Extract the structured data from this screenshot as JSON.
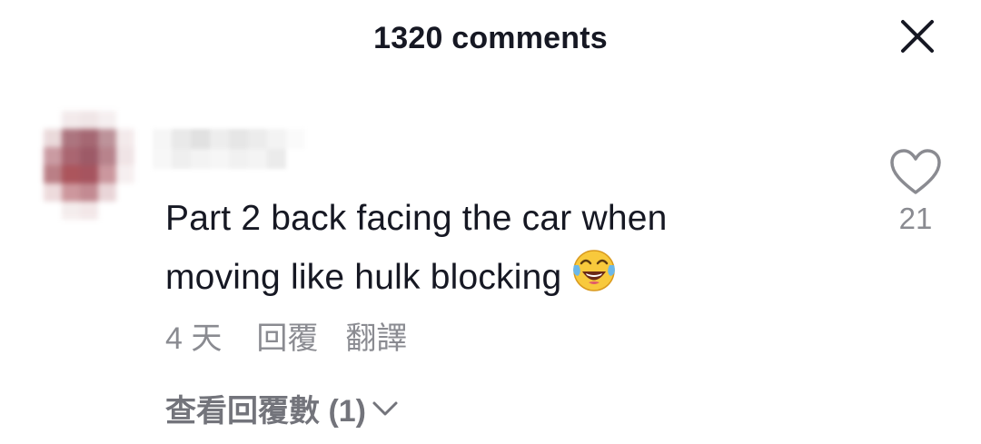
{
  "header": {
    "title": "1320 comments"
  },
  "comment": {
    "username": "",
    "text": "Part 2 back facing the car when moving like hulk blocking",
    "emoji": "😂",
    "time": "4 天",
    "reply_label": "回覆",
    "translate_label": "翻譯",
    "like_count": "21",
    "view_replies_label": "查看回覆數 (1)"
  },
  "icons": {
    "close": "close-icon",
    "like": "heart-outline-icon",
    "chevron": "chevron-down-icon",
    "emoji": "tears-of-joy-emoji"
  },
  "colors": {
    "text_primary": "#161823",
    "text_secondary": "#8a8b91",
    "background": "#ffffff"
  }
}
